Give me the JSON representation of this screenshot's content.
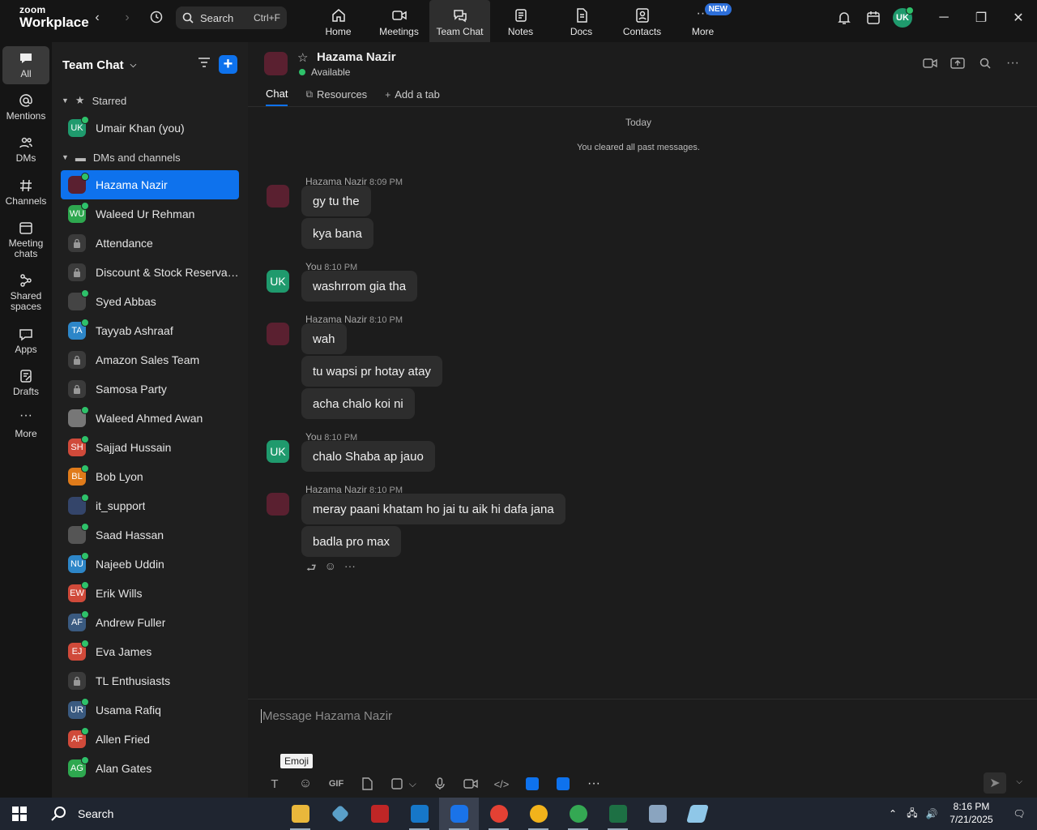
{
  "topbar": {
    "logo_line1": "zoom",
    "logo_line2": "Workplace",
    "search_label": "Search",
    "search_shortcut": "Ctrl+F",
    "nav": [
      {
        "label": "Home",
        "icon": "home-icon"
      },
      {
        "label": "Meetings",
        "icon": "camera-icon"
      },
      {
        "label": "Team Chat",
        "icon": "chat-bubbles-icon"
      },
      {
        "label": "Notes",
        "icon": "notes-icon"
      },
      {
        "label": "Docs",
        "icon": "doc-icon"
      },
      {
        "label": "Contacts",
        "icon": "contacts-icon"
      },
      {
        "label": "More",
        "icon": "more-icon"
      }
    ],
    "new_badge": "NEW",
    "avatar_initials": "UK"
  },
  "rail": [
    {
      "label": "All"
    },
    {
      "label": "Mentions"
    },
    {
      "label": "DMs"
    },
    {
      "label": "Channels"
    },
    {
      "label": "Meeting chats"
    },
    {
      "label": "Shared spaces"
    },
    {
      "label": "Apps"
    },
    {
      "label": "Drafts"
    },
    {
      "label": "More"
    }
  ],
  "sidebar": {
    "title": "Team Chat",
    "starred_label": "Starred",
    "starred_items": [
      {
        "name": "Umair Khan (you)",
        "initials": "UK",
        "color": "#1f9a6d"
      }
    ],
    "dms_label": "DMs and channels",
    "items": [
      {
        "name": "Hazama Nazir",
        "initials": "",
        "color": "#5a2030"
      },
      {
        "name": "Waleed Ur Rehman",
        "initials": "WU",
        "color": "#2ea84f"
      },
      {
        "name": "Attendance",
        "initials": "",
        "color": "#3b3b3b"
      },
      {
        "name": "Discount & Stock Reservati...",
        "initials": "",
        "color": "#3b3b3b"
      },
      {
        "name": "Syed Abbas",
        "initials": "",
        "color": "#444444"
      },
      {
        "name": "Tayyab Ashraaf",
        "initials": "TA",
        "color": "#2d86c8"
      },
      {
        "name": "Amazon Sales Team",
        "initials": "",
        "color": "#3b3b3b"
      },
      {
        "name": "Samosa Party",
        "initials": "",
        "color": "#3b3b3b"
      },
      {
        "name": "Waleed Ahmed Awan",
        "initials": "",
        "color": "#777777"
      },
      {
        "name": "Sajjad Hussain",
        "initials": "SH",
        "color": "#d04a3a"
      },
      {
        "name": "Bob Lyon",
        "initials": "BL",
        "color": "#e07b1a"
      },
      {
        "name": "it_support",
        "initials": "",
        "color": "#34456a"
      },
      {
        "name": "Saad Hassan",
        "initials": "",
        "color": "#555555"
      },
      {
        "name": "Najeeb Uddin",
        "initials": "NU",
        "color": "#2d86c8"
      },
      {
        "name": "Erik Wills",
        "initials": "EW",
        "color": "#d04a3a"
      },
      {
        "name": "Andrew Fuller",
        "initials": "AF",
        "color": "#3a5a80"
      },
      {
        "name": "Eva James",
        "initials": "EJ",
        "color": "#d04a3a"
      },
      {
        "name": "TL Enthusiasts",
        "initials": "",
        "color": "#3b3b3b"
      },
      {
        "name": "Usama Rafiq",
        "initials": "UR",
        "color": "#3a5a80"
      },
      {
        "name": "Allen Fried",
        "initials": "AF",
        "color": "#d04a3a"
      },
      {
        "name": "Alan Gates",
        "initials": "AG",
        "color": "#2ea84f"
      }
    ]
  },
  "chat": {
    "name": "Hazama Nazir",
    "status": "Available",
    "tabs": [
      "Chat",
      "Resources",
      "Add a tab"
    ],
    "day_label": "Today",
    "cleared_note": "You cleared all past messages.",
    "groups": [
      {
        "sender": "Hazama Nazir",
        "time": "8:09 PM",
        "messages": [
          "gy tu the",
          "kya bana"
        ]
      },
      {
        "sender": "You",
        "time": "8:10 PM",
        "messages": [
          "washrrom gia tha"
        ]
      },
      {
        "sender": "Hazama Nazir",
        "time": "8:10 PM",
        "messages": [
          "wah",
          "tu wapsi pr hotay atay",
          "acha chalo koi ni"
        ]
      },
      {
        "sender": "You",
        "time": "8:10 PM",
        "messages": [
          "chalo Shaba ap jauo"
        ]
      },
      {
        "sender": "Hazama Nazir",
        "time": "8:10 PM",
        "messages": [
          "meray paani khatam ho jai tu aik hi dafa jana",
          "badla pro max"
        ]
      }
    ],
    "you_initials": "UK",
    "composer_placeholder": "Message Hazama Nazir",
    "tooltip": "Emoji",
    "gif_label": "GIF"
  },
  "taskbar": {
    "search_label": "Search",
    "time": "8:16 PM",
    "date": "7/21/2025"
  }
}
